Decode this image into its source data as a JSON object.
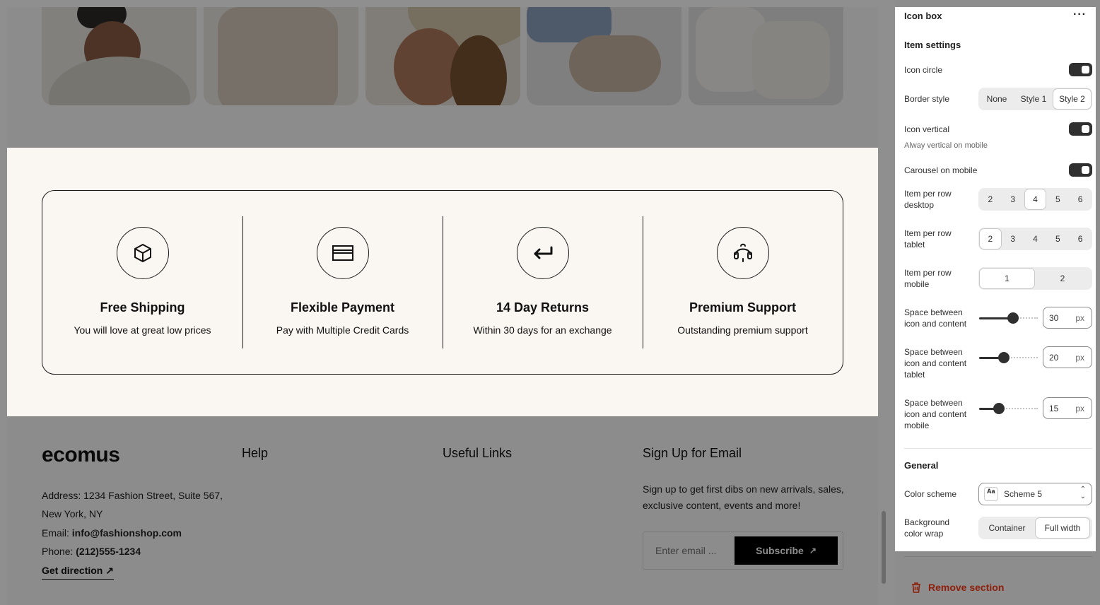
{
  "iconbox": {
    "items": [
      {
        "icon": "box-icon",
        "title": "Free Shipping",
        "desc": "You will love at great low prices"
      },
      {
        "icon": "credit-card-icon",
        "title": "Flexible Payment",
        "desc": "Pay with Multiple Credit Cards"
      },
      {
        "icon": "return-arrow-icon",
        "title": "14 Day Returns",
        "desc": "Within 30 days for an exchange"
      },
      {
        "icon": "headset-icon",
        "title": "Premium Support",
        "desc": "Outstanding premium support"
      }
    ]
  },
  "footer": {
    "logo": "ecomus",
    "address_line1": "Address: 1234 Fashion Street, Suite 567,",
    "address_line2": "New York, NY",
    "email_label": "Email:",
    "email_value": "info@fashionshop.com",
    "phone_label": "Phone:",
    "phone_value": "(212)555-1234",
    "get_direction": "Get direction",
    "help_heading": "Help",
    "useful_links_heading": "Useful Links",
    "signup_heading": "Sign Up for Email",
    "signup_text": "Sign up to get first dibs on new arrivals, sales, exclusive content, events and more!",
    "email_placeholder": "Enter email ...",
    "subscribe_label": "Subscribe"
  },
  "panel": {
    "title": "Icon box",
    "item_settings": "Item settings",
    "icon_circle": "Icon circle",
    "border_style": "Border style",
    "border_options": [
      "None",
      "Style 1",
      "Style 2"
    ],
    "border_selected": "Style 2",
    "icon_vertical": "Icon vertical",
    "icon_vertical_hint": "Alway vertical on mobile",
    "carousel_mobile": "Carousel on mobile",
    "per_row_desktop_l1": "Item per row",
    "per_row_desktop_l2": "desktop",
    "per_row_tablet_l1": "Item per row",
    "per_row_tablet_l2": "tablet",
    "per_row_mobile_l1": "Item per row",
    "per_row_mobile_l2": "mobile",
    "row_options": [
      "2",
      "3",
      "4",
      "5",
      "6"
    ],
    "desktop_selected": "4",
    "tablet_selected": "2",
    "mobile_options": [
      "1",
      "2"
    ],
    "mobile_selected": "1",
    "space_l1": "Space between",
    "space_l2": "icon and content",
    "space_tablet_l3": "tablet",
    "space_mobile_l3": "mobile",
    "space_desktop_value": "30",
    "space_tablet_value": "20",
    "space_mobile_value": "15",
    "unit": "px",
    "general": "General",
    "color_scheme": "Color scheme",
    "color_scheme_value": "Scheme 5",
    "scheme_icon_text": "Aa",
    "bg_wrap_l1": "Background",
    "bg_wrap_l2": "color wrap",
    "bg_wrap_options": [
      "Container",
      "Full width"
    ],
    "bg_wrap_selected": "Full width",
    "remove_section": "Remove section"
  },
  "colors": {
    "iconbox_bg": "#faf6f1",
    "dark": "#303030",
    "danger": "#8e1f0b"
  }
}
